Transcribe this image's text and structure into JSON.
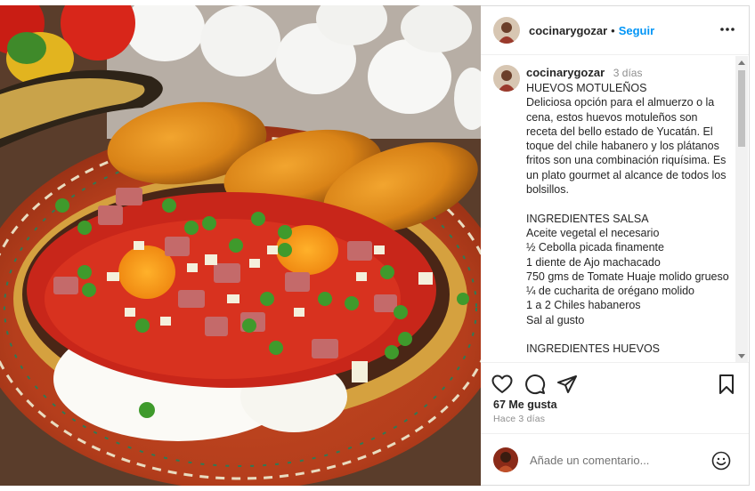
{
  "post": {
    "image": {
      "subject": "food-photo-huevos-motulenos"
    },
    "header": {
      "username": "cocinarygozar",
      "separator": "•",
      "follow_label": "Seguir",
      "more_icon": "more-horizontal-icon"
    },
    "caption": {
      "username": "cocinarygozar",
      "time": "3 días",
      "text": "HUEVOS MOTULEÑOS\nDeliciosa opción para el almuerzo o la cena, estos huevos motuleños son receta del bello estado de Yucatán. El toque del chile habanero y los plátanos fritos son una combinación riquísima. Es un plato gourmet al alcance de todos los bolsillos.\n\nINGREDIENTES SALSA\nAceite vegetal el necesario\n½ Cebolla picada finamente\n1 diente de Ajo machacado\n750 gms de Tomate Huaje molido grueso\n¼ de cucharita de orégano molido\n1 a 2 Chiles habaneros\nSal al gusto\n\nINGREDIENTES HUEVOS"
    },
    "actions": {
      "like_icon": "heart-icon",
      "comment_icon": "comment-icon",
      "share_icon": "share-icon",
      "save_icon": "bookmark-icon"
    },
    "likes": "67 Me gusta",
    "posted": "Hace 3 días",
    "comment": {
      "placeholder": "Añade un comentario...",
      "emoji_icon": "smiley-icon"
    }
  },
  "colors": {
    "accent": "#0095f6",
    "text": "#262626",
    "muted": "#8e8e8e",
    "border": "#dbdbdb"
  }
}
